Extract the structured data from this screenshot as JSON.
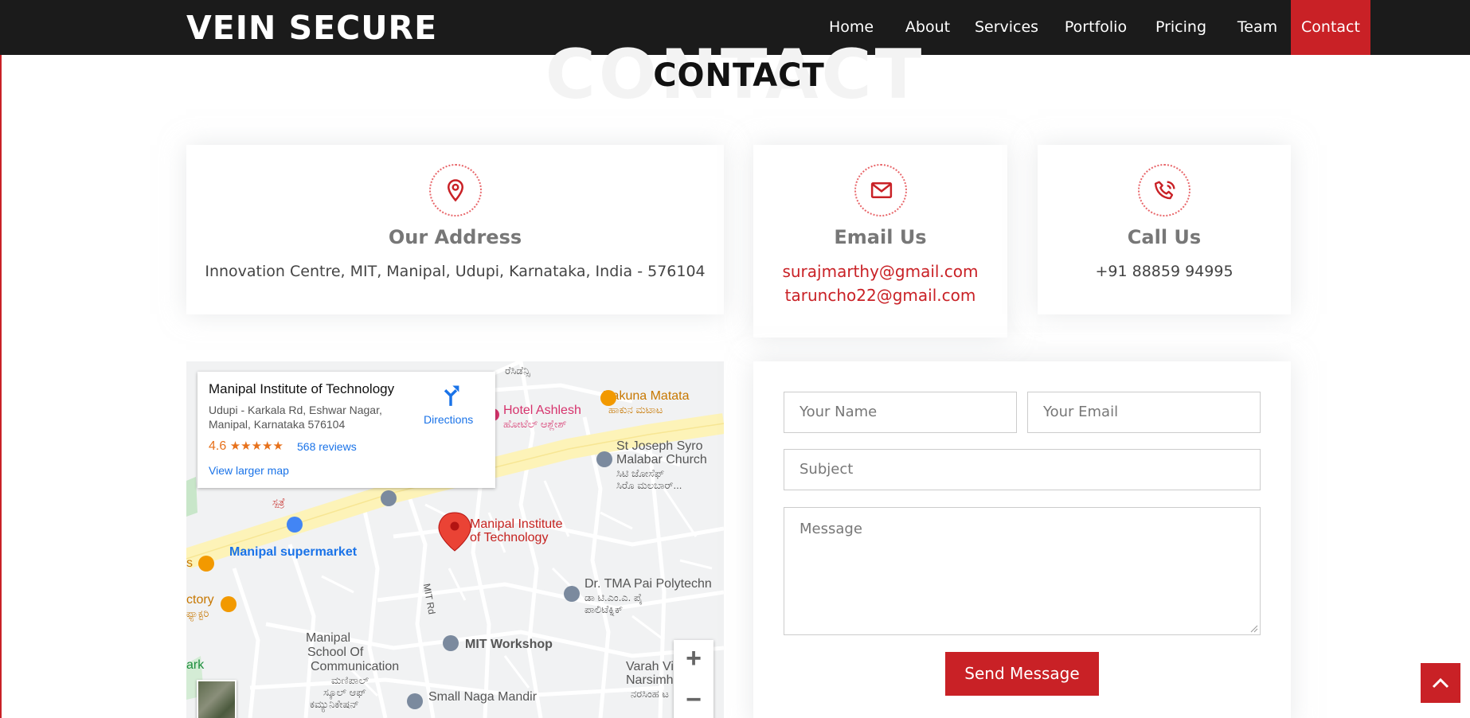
{
  "header": {
    "logo": "VEIN SECURE",
    "nav": [
      {
        "label": "Home",
        "active": false
      },
      {
        "label": "About",
        "active": false
      },
      {
        "label": "Services",
        "active": false
      },
      {
        "label": "Portfolio",
        "active": false
      },
      {
        "label": "Pricing",
        "active": false
      },
      {
        "label": "Team",
        "active": false
      },
      {
        "label": "Contact",
        "active": true
      }
    ]
  },
  "section": {
    "bg_title": "CONTACT",
    "title": "CONTACT"
  },
  "address": {
    "icon": "map-pin-icon",
    "title": "Our Address",
    "text": "Innovation Centre, MIT, Manipal, Udupi, Karnataka, India - 576104"
  },
  "email": {
    "icon": "envelope-icon",
    "title": "Email Us",
    "addresses": [
      "surajmarthy@gmail.com",
      "taruncho22@gmail.com"
    ]
  },
  "phone": {
    "icon": "phone-icon",
    "title": "Call Us",
    "number": "+91 88859 94995"
  },
  "map": {
    "card": {
      "title": "Manipal Institute of Technology",
      "address": "Udupi - Karkala Rd, Eshwar Nagar, Manipal, Karnataka 576104",
      "rating": "4.6",
      "stars": "★★★★★",
      "reviews": "568 reviews",
      "larger_map": "View larger map",
      "directions": "Directions"
    },
    "labels": {
      "hotel": "Hotel Ashlesh",
      "hotel_kn": "ಹೋಟೆಲ್ ಆಶ್ಲೇಶ್",
      "hakuna": "Hakuna Matata",
      "hakuna_kn": "ಹಾಕುನ ಮಟಾಟ",
      "church1": "St Joseph Syro",
      "church2": "Malabar Church",
      "church_kn1": "ಸಿಟಿ ಜೋಸೆಫ್",
      "church_kn2": "ಸಿರೊ ಮಲಬಾರ್...",
      "mit1": "Manipal Institute",
      "mit2": "of Technology",
      "supermarket": "Manipal supermarket",
      "hospital_kn1": "ಸ್ಪತ್ರೆ",
      "polytech1": "Dr. TMA Pai Polytechn",
      "polytech_kn1": "ಡಾ ಟಿ.ಎಂ.ಎ. ಪೈ",
      "polytech_kn2": "ಪಾಲಿಟೆಕ್ನಿಕ್",
      "road": "MIT Rd",
      "workshop": "MIT Workshop",
      "school1": "Manipal",
      "school2": "School Of",
      "school3": "Communication",
      "school_kn1": "ಮಣಿಪಾಲ್",
      "school_kn2": "ಸ್ಕೂಲ್ ಆಫ್",
      "school_kn3": "ಕಮ್ಯುನಿಕೇಷನ್",
      "varah1": "Varah Vishnu",
      "varah2": "Narsimha Te",
      "varah_kn": "ನರಸಿಂಹ ಟ",
      "naga": "Small Naga Mandir",
      "factory": "ctory",
      "factory_kn": "ಫ್ಯಾಕ್ಟರಿ",
      "park": "ark",
      "residency_kn": "ರೆಸಿಡೆನ್ಸಿ",
      "s_label": "s"
    },
    "zoom_in": "+",
    "zoom_out": "−"
  },
  "form": {
    "name_placeholder": "Your Name",
    "email_placeholder": "Your Email",
    "subject_placeholder": "Subject",
    "message_placeholder": "Message",
    "send_label": "Send Message"
  },
  "colors": {
    "accent": "#c92126",
    "header_bg": "#1b1b1b"
  },
  "back_to_top": {
    "icon": "chevron-up-icon"
  }
}
